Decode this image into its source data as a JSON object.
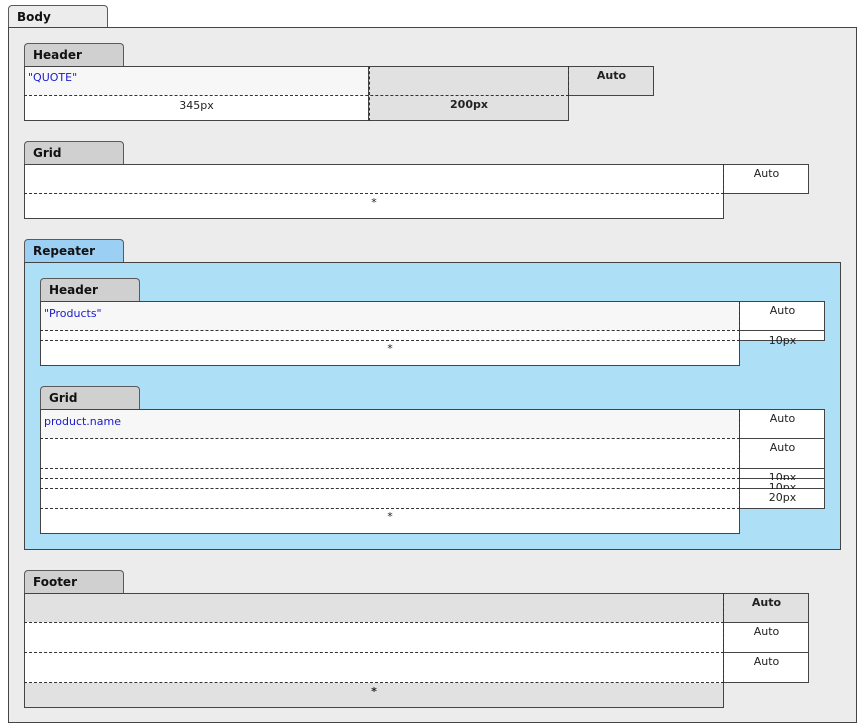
{
  "body": {
    "tab_label": "Body"
  },
  "header": {
    "tab_label": "Header",
    "binding": "\"QUOTE\"",
    "col_width_1": "345px",
    "col_width_2": "200px",
    "row_height": "Auto"
  },
  "grid": {
    "tab_label": "Grid",
    "row_height": "Auto",
    "col_width": "*"
  },
  "repeater": {
    "tab_label": "Repeater",
    "header": {
      "tab_label": "Header",
      "binding": "\"Products\"",
      "row_height_1": "Auto",
      "row_height_2": "10px",
      "col_width": "*"
    },
    "grid": {
      "tab_label": "Grid",
      "binding": "product.name",
      "row_heights": [
        "Auto",
        "Auto",
        "10px",
        "10px",
        "20px"
      ],
      "col_width": "*"
    }
  },
  "footer": {
    "tab_label": "Footer",
    "row_heights": [
      "Auto",
      "Auto",
      "Auto"
    ],
    "col_width": "*"
  },
  "colors": {
    "canvas": "#ececec",
    "band_header": "#e1e1e1",
    "repeater": "#addff7",
    "tab": "#d0d0d0",
    "binding_text": "#1a1acc"
  }
}
